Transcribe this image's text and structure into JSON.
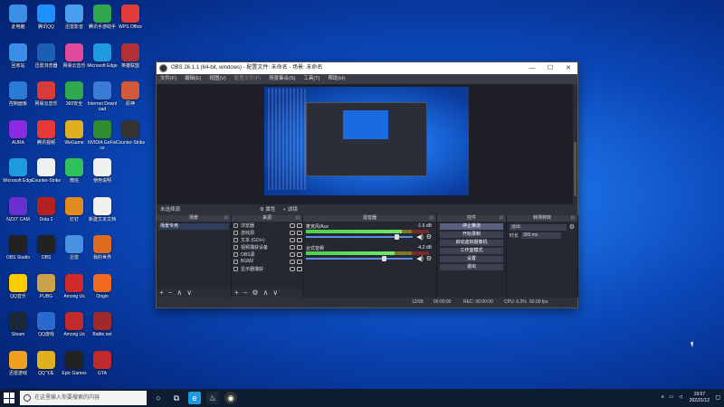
{
  "desktop": {
    "icons": [
      {
        "label": "此电脑",
        "col": 0,
        "row": 0,
        "color": "#3a8ee6",
        "glyph": "computer-icon"
      },
      {
        "label": "腾讯QQ",
        "col": 1,
        "row": 0,
        "color": "#1e90ff",
        "glyph": "qq-icon"
      },
      {
        "label": "迅雷影音",
        "col": 2,
        "row": 0,
        "color": "#4aa0f0",
        "glyph": "player-icon"
      },
      {
        "label": "腾讯手游助手",
        "col": 3,
        "row": 0,
        "color": "#2fa84f",
        "glyph": "game-assistant-icon"
      },
      {
        "label": "WPS Office",
        "col": 4,
        "row": 0,
        "color": "#e23b3b",
        "glyph": "wps-icon"
      },
      {
        "label": "回收站",
        "col": 0,
        "row": 1,
        "color": "#3a8ee6",
        "glyph": "recycle-bin-icon"
      },
      {
        "label": "迅雷浏览器",
        "col": 1,
        "row": 1,
        "color": "#1a5fb4",
        "glyph": "browser-icon"
      },
      {
        "label": "网易云音乐",
        "col": 2,
        "row": 1,
        "color": "#e04a9a",
        "glyph": "music-icon"
      },
      {
        "label": "Microsoft Edge",
        "col": 3,
        "row": 1,
        "color": "#1e9be0",
        "glyph": "edge-icon"
      },
      {
        "label": "英雄联盟",
        "col": 4,
        "row": 1,
        "color": "#b0303a",
        "glyph": "lol-icon"
      },
      {
        "label": "控制面板",
        "col": 0,
        "row": 2,
        "color": "#2a7ad8",
        "glyph": "control-panel-icon"
      },
      {
        "label": "网易云音乐",
        "col": 1,
        "row": 2,
        "color": "#d93a3a",
        "glyph": "netease-icon"
      },
      {
        "label": "360安全",
        "col": 2,
        "row": 2,
        "color": "#2fa84f",
        "glyph": "shield-icon"
      },
      {
        "label": "Internet Download",
        "col": 3,
        "row": 2,
        "color": "#3a7bd5",
        "glyph": "download-icon"
      },
      {
        "label": "原神",
        "col": 4,
        "row": 2,
        "color": "#d05a3a",
        "glyph": "genshin-icon"
      },
      {
        "label": "AURA",
        "col": 0,
        "row": 3,
        "color": "#8a2be2",
        "glyph": "aura-icon"
      },
      {
        "label": "腾讯视频",
        "col": 1,
        "row": 3,
        "color": "#e63a3a",
        "glyph": "video-icon"
      },
      {
        "label": "WeGame",
        "col": 2,
        "row": 3,
        "color": "#e0b020",
        "glyph": "wegame-icon"
      },
      {
        "label": "NVIDIA GeForce",
        "col": 3,
        "row": 3,
        "color": "#2e8b2e",
        "glyph": "nvidia-icon"
      },
      {
        "label": "Counter-Strike",
        "col": 4,
        "row": 3,
        "color": "#333333",
        "glyph": "cs-icon"
      },
      {
        "label": "Microsoft Edge",
        "col": 0,
        "row": 4,
        "color": "#1e9be0",
        "glyph": "edge-icon"
      },
      {
        "label": "Counter-Strike",
        "col": 1,
        "row": 4,
        "color": "#f0f0f0",
        "glyph": "document-icon"
      },
      {
        "label": "微信",
        "col": 2,
        "row": 4,
        "color": "#2fc25b",
        "glyph": "wechat-icon"
      },
      {
        "label": "使用说明",
        "col": 3,
        "row": 4,
        "color": "#f0f0f0",
        "glyph": "document-icon"
      },
      {
        "label": "NZXT CAM",
        "col": 0,
        "row": 5,
        "color": "#6a2fcf",
        "glyph": "nzxt-icon"
      },
      {
        "label": "Dota 2",
        "col": 1,
        "row": 5,
        "color": "#b52020",
        "glyph": "dota-icon"
      },
      {
        "label": "钉钉",
        "col": 2,
        "row": 5,
        "color": "#e08a20",
        "glyph": "dingtalk-icon"
      },
      {
        "label": "新建文本文档",
        "col": 3,
        "row": 5,
        "color": "#f0f0f0",
        "glyph": "document-icon"
      },
      {
        "label": "OBS Studio",
        "col": 0,
        "row": 6,
        "color": "#222222",
        "glyph": "obs-icon"
      },
      {
        "label": "OBS",
        "col": 1,
        "row": 6,
        "color": "#222222",
        "glyph": "obs-icon"
      },
      {
        "label": "迅雷",
        "col": 2,
        "row": 6,
        "color": "#4a90e2",
        "glyph": "thunder-icon"
      },
      {
        "label": "我的世界",
        "col": 3,
        "row": 6,
        "color": "#e06a20",
        "glyph": "minecraft-icon"
      },
      {
        "label": "QQ音乐",
        "col": 0,
        "row": 7,
        "color": "#ffcc00",
        "glyph": "qq-music-icon"
      },
      {
        "label": "PUBG",
        "col": 1,
        "row": 7,
        "color": "#caa24a",
        "glyph": "pubg-icon"
      },
      {
        "label": "Among Us",
        "col": 2,
        "row": 7,
        "color": "#d02a2a",
        "glyph": "among-us-icon"
      },
      {
        "label": "Origin",
        "col": 3,
        "row": 7,
        "color": "#f06a20",
        "glyph": "origin-icon"
      },
      {
        "label": "Steam",
        "col": 0,
        "row": 8,
        "color": "#1b2838",
        "glyph": "steam-icon"
      },
      {
        "label": "QQ游戏",
        "col": 1,
        "row": 8,
        "color": "#2a6ad0",
        "glyph": "qq-game-icon"
      },
      {
        "label": "Among Us",
        "col": 2,
        "row": 8,
        "color": "#c02a2a",
        "glyph": "among-us-icon"
      },
      {
        "label": "Battle.net",
        "col": 3,
        "row": 8,
        "color": "#a02a2a",
        "glyph": "battlenet-icon"
      },
      {
        "label": "迅雷游戏",
        "col": 0,
        "row": 9,
        "color": "#f0a020",
        "glyph": "game-icon"
      },
      {
        "label": "QQ飞车",
        "col": 1,
        "row": 9,
        "color": "#e0b020",
        "glyph": "car-icon"
      },
      {
        "label": "Epic Games",
        "col": 2,
        "row": 9,
        "color": "#222222",
        "glyph": "epic-icon"
      },
      {
        "label": "GTA",
        "col": 3,
        "row": 9,
        "color": "#c02a2a",
        "glyph": "gta-icon"
      }
    ]
  },
  "obs": {
    "title": "OBS 26.1.1 (64-bit, windows) - 配置文件: 未命名 - 场景: 未命名",
    "window_buttons": [
      "—",
      "☐",
      "✕"
    ],
    "menu": [
      {
        "label": "文件(F)",
        "dim": false
      },
      {
        "label": "编辑(E)",
        "dim": false
      },
      {
        "label": "视图(V)",
        "dim": false
      },
      {
        "label": "配置文件(P)",
        "dim": true
      },
      {
        "label": "场景集合(S)",
        "dim": false
      },
      {
        "label": "工具(T)",
        "dim": false
      },
      {
        "label": "帮助(H)",
        "dim": false
      }
    ],
    "context_bar": {
      "no_source": "未选择源",
      "properties": "属性",
      "filters": "滤镜"
    },
    "docks": {
      "scenes": {
        "title": "场景",
        "items": [
          "场景专用"
        ]
      },
      "sources": {
        "title": "来源",
        "items": [
          "浏览器",
          "游戏源",
          "文本 (GDI+)",
          "视频捕获设备",
          "OBS源",
          "BGM2",
          "显示器捕获"
        ]
      },
      "mixer": {
        "title": "混音器",
        "tracks": [
          {
            "name": "麦克风/Aux",
            "db": "-1.6 dB",
            "level": 0.78,
            "volume": 0.86
          },
          {
            "name": "台式音频",
            "db": "-4.2 dB",
            "level": 0.72,
            "volume": 0.74
          }
        ]
      },
      "controls": {
        "title": "控件",
        "buttons": [
          "停止推流",
          "开始录制",
          "启动虚拟摄像机",
          "工作室模式",
          "设置",
          "退出"
        ],
        "active_index": 0
      },
      "transitions": {
        "title": "转场特效",
        "type": "淡出",
        "duration_label": "时长",
        "duration_value": "300 ms"
      }
    },
    "statusbar": {
      "dropped": "12/99",
      "live": "00:00:00",
      "rec": "REC: 00:00:00",
      "cpu": "CPU: 0.3%",
      "fps": "60.00 fps"
    }
  },
  "taskbar": {
    "search_placeholder": "在这里输入你要搜索的内容",
    "time": "19:57",
    "date": "2022/1/12"
  }
}
